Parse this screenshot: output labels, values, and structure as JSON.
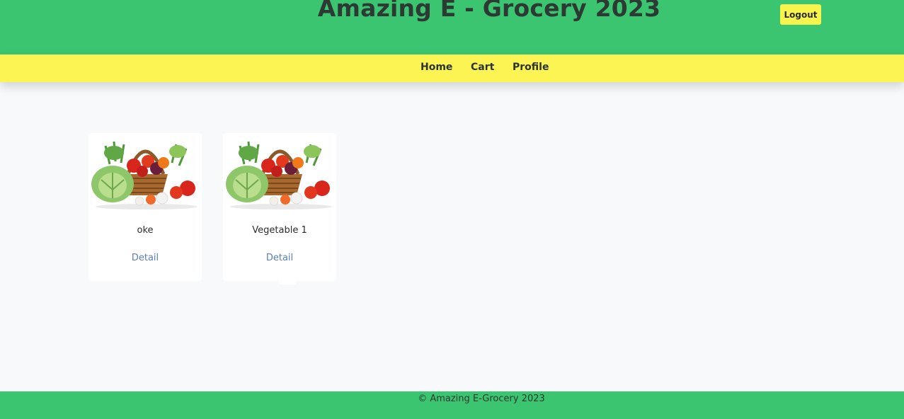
{
  "header": {
    "title": "Amazing E - Grocery 2023",
    "logout_label": "Logout"
  },
  "nav": {
    "items": [
      {
        "label": "Home"
      },
      {
        "label": "Cart"
      },
      {
        "label": "Profile"
      }
    ]
  },
  "products": [
    {
      "name": "oke",
      "link_label": "Detail",
      "image": "vegetable-basket-image"
    },
    {
      "name": "Vegetable 1",
      "link_label": "Detail",
      "image": "vegetable-basket-image"
    }
  ],
  "footer": {
    "text": "© Amazing E-Grocery 2023"
  },
  "colors": {
    "header_bg": "#3cc571",
    "nav_bg": "#fbf452",
    "button_bg": "#f8f44e",
    "link": "#5a7fb3",
    "page_bg": "#f8f9fb"
  }
}
